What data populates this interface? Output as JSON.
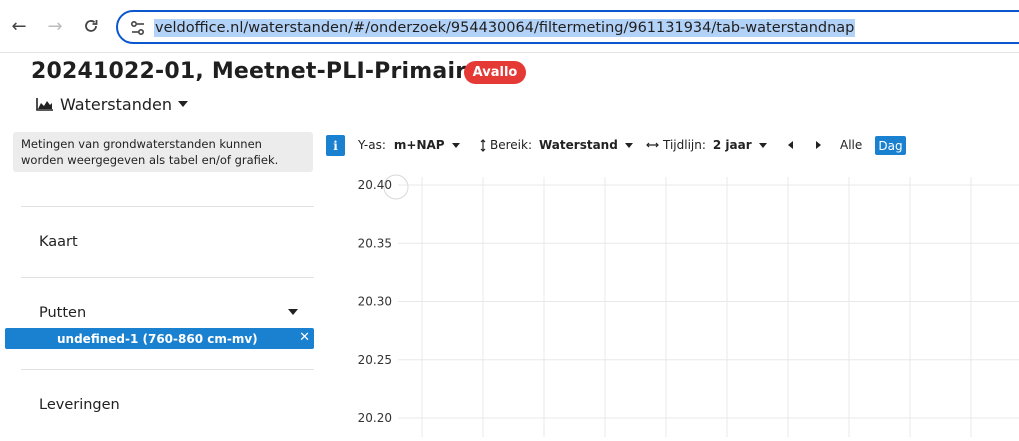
{
  "browser": {
    "url": "veldoffice.nl/waterstanden/#/onderzoek/954430064/filtermeting/961131934/tab-waterstandnap",
    "back_icon": "arrow-left-icon",
    "forward_icon": "arrow-right-icon",
    "reload_icon": "reload-icon",
    "site_info_icon": "tune-icon"
  },
  "header": {
    "title": "20241022-01, Meetnet-PLI-Primair",
    "badge": "Avallo",
    "badge_color": "#e53935",
    "view_label": "Waterstanden",
    "view_icon": "area-chart-icon"
  },
  "sidebar": {
    "info_text": "Metingen van grondwaterstanden kunnen worden weergegeven als tabel en/of grafiek.",
    "kaart_label": "Kaart",
    "putten_label": "Putten",
    "selected_put": "undefined-1 (760-860 cm-mv)",
    "leveringen_label": "Leveringen",
    "accent_color": "#1a80d0"
  },
  "chart_controls": {
    "info_button": "i",
    "yas_label": "Y-as:",
    "yas_value": "m+NAP",
    "bereik_label": "Bereik:",
    "bereik_value": "Waterstand",
    "tijdlijn_label": "Tijdlijn:",
    "tijdlijn_value": "2 jaar",
    "alle_label": "Alle",
    "dag_label": "Dag"
  },
  "chart_data": {
    "type": "line",
    "title": "",
    "xlabel": "",
    "ylabel": "",
    "y_ticks": [
      "20.40",
      "20.35",
      "20.30",
      "20.25",
      "20.20"
    ],
    "ylim": [
      20.2,
      20.4
    ],
    "series": [],
    "grid": true
  }
}
